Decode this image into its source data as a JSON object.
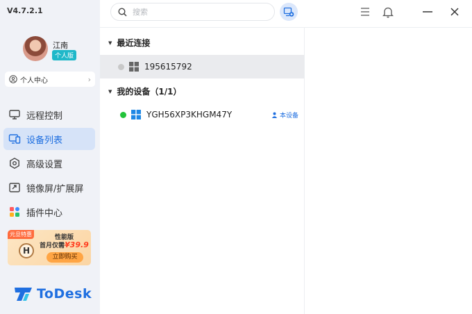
{
  "app": {
    "version": "V4.7.2.1",
    "brand": "ToDesk",
    "accent": "#1f6fe0"
  },
  "user": {
    "name": "江南",
    "plan": "个人版"
  },
  "personal_center": {
    "label": "个人中心"
  },
  "nav": {
    "items": [
      {
        "label": "远程控制",
        "icon": "monitor-icon"
      },
      {
        "label": "设备列表",
        "icon": "devices-icon"
      },
      {
        "label": "高级设置",
        "icon": "settings-icon"
      },
      {
        "label": "镜像屏/扩展屏",
        "icon": "mirror-screen-icon"
      },
      {
        "label": "插件中心",
        "icon": "plugins-icon"
      }
    ],
    "active_index": 1
  },
  "promo": {
    "tag": "元旦特惠",
    "edition": "性能版",
    "first_month": "首月仅需",
    "price": "¥39.9",
    "button": "立即购买"
  },
  "search": {
    "placeholder": "搜索",
    "value": ""
  },
  "recent": {
    "title": "最近连接",
    "items": [
      {
        "id": "195615792",
        "status": "offline",
        "status_color": "#c8c8c8"
      }
    ]
  },
  "my_devices": {
    "title": "我的设备（1/1）",
    "items": [
      {
        "name": "YGH56XP3KHGM47Y",
        "status": "online",
        "status_color": "#22c33a",
        "badge": "本设备"
      }
    ]
  }
}
